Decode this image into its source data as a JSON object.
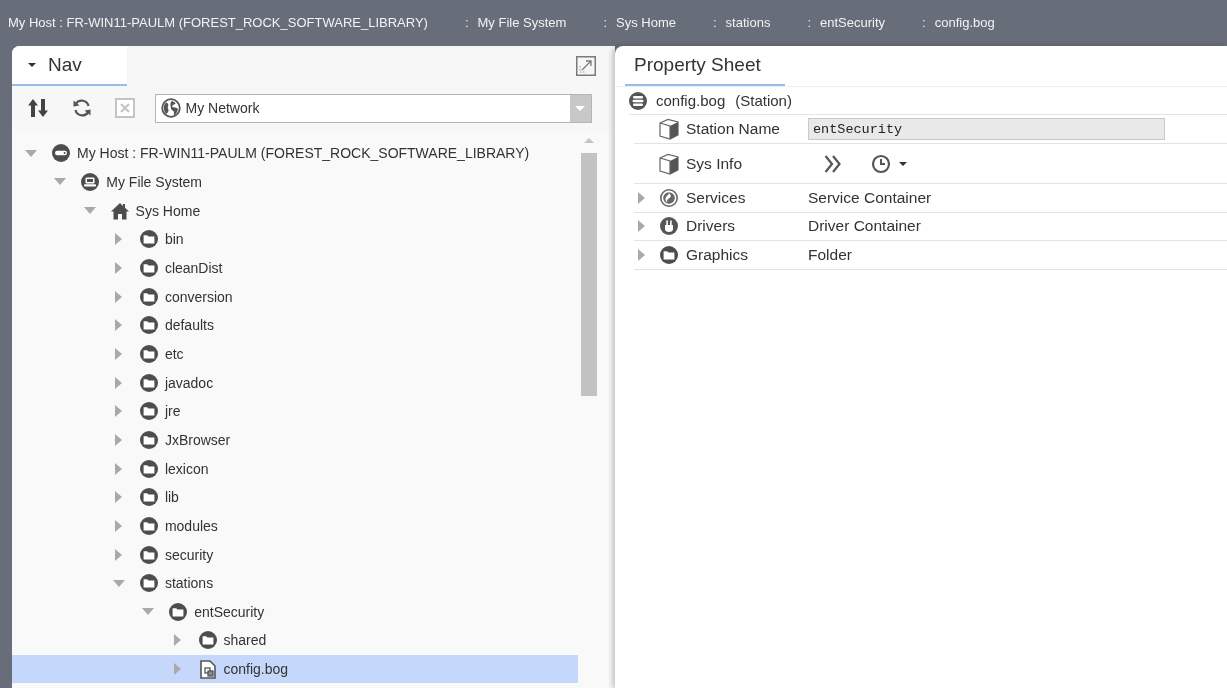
{
  "breadcrumb": [
    {
      "label": "My Host : FR-WIN11-PAULM (FOREST_ROCK_SOFTWARE_LIBRARY)"
    },
    {
      "separator": ":",
      "label": "My File System"
    },
    {
      "separator": ":",
      "label": "Sys Home"
    },
    {
      "separator": ":",
      "label": "stations"
    },
    {
      "separator": ":",
      "label": "entSecurity"
    },
    {
      "separator": ":",
      "label": "config.bog"
    }
  ],
  "nav": {
    "tab": {
      "label": "Nav",
      "selected": true
    },
    "toolbar": [
      {
        "kind": "sort",
        "disabled": false
      },
      {
        "kind": "refresh",
        "disabled": false
      },
      {
        "kind": "close",
        "disabled": true
      }
    ],
    "location": {
      "value": "My Network"
    },
    "tree": [
      {
        "kind": "host",
        "label": "My Host : FR-WIN11-PAULM (FOREST_ROCK_SOFTWARE_LIBRARY)",
        "expanded": true,
        "selected": false,
        "children": [
          {
            "kind": "filesystem",
            "label": "My File System",
            "expanded": true,
            "selected": false,
            "children": [
              {
                "kind": "home",
                "label": "Sys Home",
                "expanded": true,
                "selected": false,
                "children": [
                  {
                    "kind": "folder",
                    "label": "bin",
                    "expanded": false,
                    "selected": false
                  },
                  {
                    "kind": "folder",
                    "label": "cleanDist",
                    "expanded": false,
                    "selected": false
                  },
                  {
                    "kind": "folder",
                    "label": "conversion",
                    "expanded": false,
                    "selected": false
                  },
                  {
                    "kind": "folder",
                    "label": "defaults",
                    "expanded": false,
                    "selected": false
                  },
                  {
                    "kind": "folder",
                    "label": "etc",
                    "expanded": false,
                    "selected": false
                  },
                  {
                    "kind": "folder",
                    "label": "javadoc",
                    "expanded": false,
                    "selected": false
                  },
                  {
                    "kind": "folder",
                    "label": "jre",
                    "expanded": false,
                    "selected": false
                  },
                  {
                    "kind": "folder",
                    "label": "JxBrowser",
                    "expanded": false,
                    "selected": false
                  },
                  {
                    "kind": "folder",
                    "label": "lexicon",
                    "expanded": false,
                    "selected": false
                  },
                  {
                    "kind": "folder",
                    "label": "lib",
                    "expanded": false,
                    "selected": false
                  },
                  {
                    "kind": "folder",
                    "label": "modules",
                    "expanded": false,
                    "selected": false
                  },
                  {
                    "kind": "folder",
                    "label": "security",
                    "expanded": false,
                    "selected": false
                  },
                  {
                    "kind": "folder",
                    "label": "stations",
                    "expanded": true,
                    "selected": false,
                    "children": [
                      {
                        "kind": "folder",
                        "label": "entSecurity",
                        "expanded": true,
                        "selected": false,
                        "children": [
                          {
                            "kind": "folder",
                            "label": "shared",
                            "expanded": false,
                            "selected": false
                          },
                          {
                            "kind": "file",
                            "label": "config.bog",
                            "expanded": false,
                            "selected": true
                          }
                        ]
                      }
                    ]
                  }
                ]
              }
            ]
          }
        ]
      }
    ]
  },
  "property_sheet": {
    "tab": {
      "label": "Property Sheet",
      "selected": true
    },
    "component": {
      "name": "config.bog",
      "type": "(Station)"
    },
    "properties": [
      {
        "kind": "string",
        "label": "Station Name",
        "value": "entSecurity"
      },
      {
        "kind": "action",
        "label": "Sys Info"
      },
      {
        "kind": "services",
        "label": "Services",
        "value": "Service Container",
        "expanded": false
      },
      {
        "kind": "drivers",
        "label": "Drivers",
        "value": "Driver Container",
        "expanded": false
      },
      {
        "kind": "folder",
        "label": "Graphics",
        "value": "Folder",
        "expanded": false
      }
    ]
  }
}
